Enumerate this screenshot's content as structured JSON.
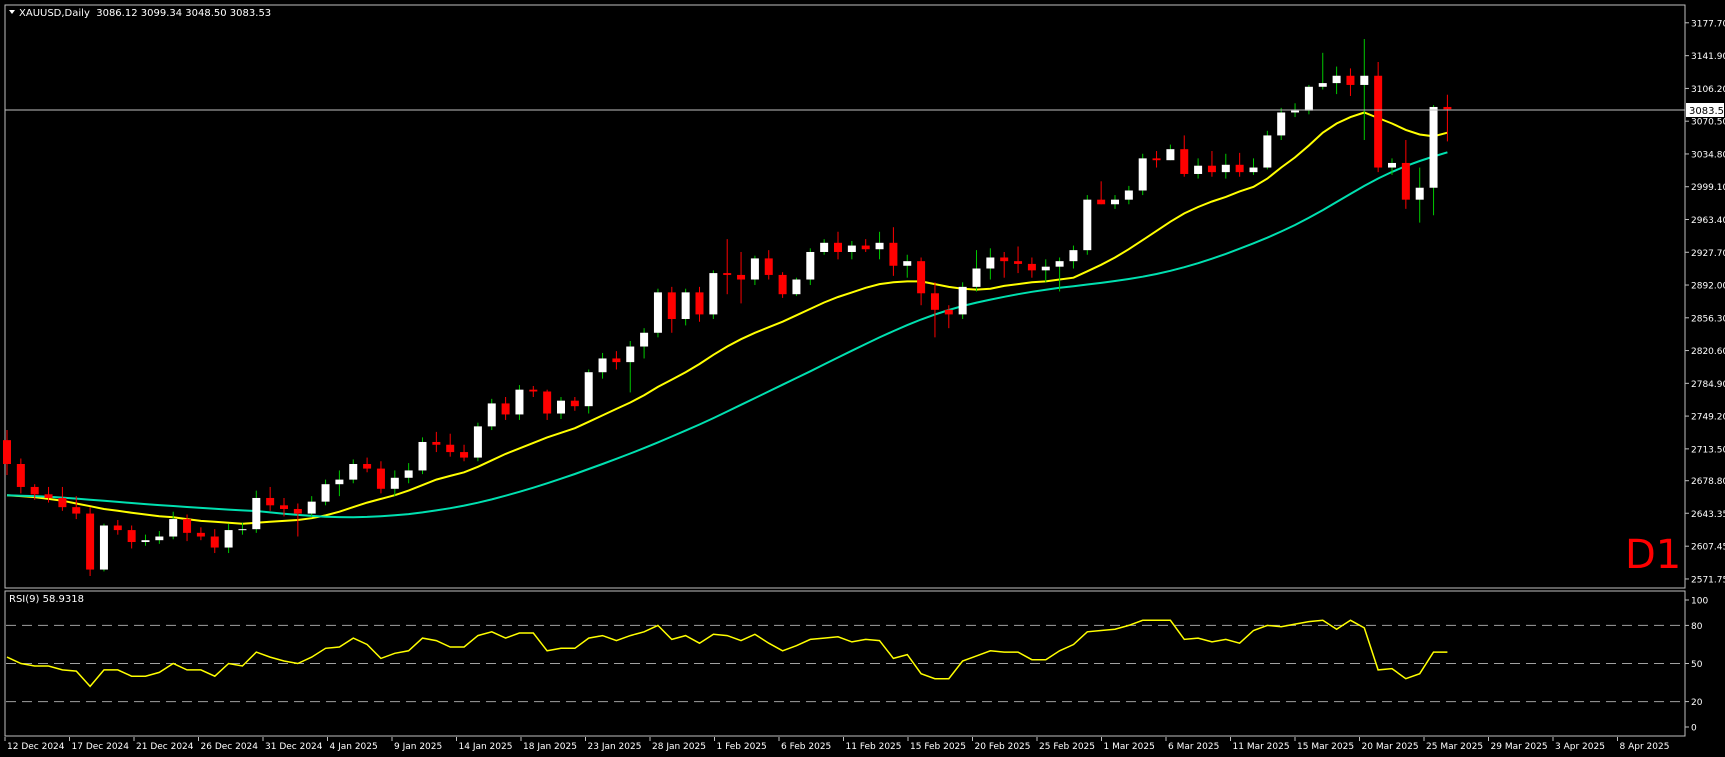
{
  "header": {
    "symbol_line": "XAUUSD,Daily  3086.12 3099.34 3048.50 3083.53",
    "watermark": "D1",
    "current_price_label": "3083.53"
  },
  "rsi_header": "RSI(9) 58.9318",
  "colors": {
    "background": "#000000",
    "frame": "#c0c0c0",
    "bull_body": "#ffffff",
    "bull_wick": "#00c800",
    "bear": "#ff0000",
    "ma_fast": "#ffff00",
    "ma_slow": "#00e0b0",
    "rsi_line": "#ffff00",
    "text": "#ffffff",
    "watermark": "#ff0000"
  },
  "chart_data": [
    {
      "type": "candlestick",
      "title": "XAUUSD,Daily",
      "ohlc_last": {
        "open": 3086.12,
        "high": 3099.34,
        "low": 3048.5,
        "close": 3083.53
      },
      "ylim": [
        2563,
        3196
      ],
      "yticks": [
        3177.7,
        3141.9,
        3106.2,
        3070.5,
        3034.8,
        2999.1,
        2963.4,
        2927.7,
        2892.0,
        2856.3,
        2820.6,
        2784.9,
        2749.2,
        2713.5,
        2678.8,
        2643.35,
        2607.45,
        2571.75
      ],
      "xticks": [
        "12 Dec 2024",
        "17 Dec 2024",
        "21 Dec 2024",
        "26 Dec 2024",
        "31 Dec 2024",
        "4 Jan 2025",
        "9 Jan 2025",
        "14 Jan 2025",
        "18 Jan 2025",
        "23 Jan 2025",
        "28 Jan 2025",
        "1 Feb 2025",
        "6 Feb 2025",
        "11 Feb 2025",
        "15 Feb 2025",
        "20 Feb 2025",
        "25 Feb 2025",
        "1 Mar 2025",
        "6 Mar 2025",
        "11 Mar 2025",
        "15 Mar 2025",
        "20 Mar 2025",
        "25 Mar 2025",
        "29 Mar 2025",
        "3 Apr 2025",
        "8 Apr 2025"
      ],
      "candles": [
        [
          2723,
          2734,
          2685,
          2697
        ],
        [
          2697,
          2703,
          2665,
          2672
        ],
        [
          2672,
          2675,
          2658,
          2664
        ],
        [
          2664,
          2672,
          2655,
          2660
        ],
        [
          2660,
          2672,
          2646,
          2650
        ],
        [
          2650,
          2662,
          2637,
          2643
        ],
        [
          2643,
          2650,
          2575,
          2582
        ],
        [
          2582,
          2632,
          2580,
          2630
        ],
        [
          2630,
          2636,
          2620,
          2625
        ],
        [
          2625,
          2630,
          2605,
          2612
        ],
        [
          2612,
          2620,
          2608,
          2614
        ],
        [
          2614,
          2624,
          2610,
          2618
        ],
        [
          2618,
          2645,
          2615,
          2637
        ],
        [
          2637,
          2642,
          2613,
          2622
        ],
        [
          2622,
          2628,
          2614,
          2618
        ],
        [
          2618,
          2626,
          2600,
          2606
        ],
        [
          2606,
          2632,
          2600,
          2625
        ],
        [
          2625,
          2633,
          2620,
          2626
        ],
        [
          2626,
          2668,
          2622,
          2660
        ],
        [
          2660,
          2672,
          2646,
          2652
        ],
        [
          2652,
          2660,
          2640,
          2648
        ],
        [
          2648,
          2654,
          2618,
          2643
        ],
        [
          2643,
          2662,
          2640,
          2656
        ],
        [
          2656,
          2680,
          2652,
          2675
        ],
        [
          2675,
          2690,
          2662,
          2680
        ],
        [
          2680,
          2702,
          2676,
          2697
        ],
        [
          2697,
          2704,
          2688,
          2692
        ],
        [
          2692,
          2700,
          2665,
          2670
        ],
        [
          2670,
          2690,
          2662,
          2682
        ],
        [
          2682,
          2698,
          2676,
          2690
        ],
        [
          2690,
          2726,
          2686,
          2721
        ],
        [
          2721,
          2732,
          2710,
          2718
        ],
        [
          2718,
          2730,
          2705,
          2710
        ],
        [
          2710,
          2718,
          2700,
          2704
        ],
        [
          2704,
          2742,
          2700,
          2738
        ],
        [
          2738,
          2768,
          2734,
          2763
        ],
        [
          2763,
          2770,
          2745,
          2751
        ],
        [
          2751,
          2783,
          2745,
          2778
        ],
        [
          2778,
          2782,
          2770,
          2776
        ],
        [
          2776,
          2778,
          2745,
          2752
        ],
        [
          2752,
          2770,
          2746,
          2766
        ],
        [
          2766,
          2770,
          2755,
          2760
        ],
        [
          2760,
          2800,
          2752,
          2797
        ],
        [
          2797,
          2818,
          2790,
          2812
        ],
        [
          2812,
          2820,
          2800,
          2808
        ],
        [
          2808,
          2831,
          2775,
          2825
        ],
        [
          2825,
          2845,
          2812,
          2840
        ],
        [
          2840,
          2888,
          2835,
          2884
        ],
        [
          2884,
          2890,
          2840,
          2855
        ],
        [
          2855,
          2888,
          2848,
          2884
        ],
        [
          2884,
          2890,
          2852,
          2860
        ],
        [
          2860,
          2908,
          2855,
          2905
        ],
        [
          2905,
          2942,
          2882,
          2903
        ],
        [
          2903,
          2928,
          2872,
          2898
        ],
        [
          2898,
          2924,
          2892,
          2921
        ],
        [
          2921,
          2930,
          2898,
          2903
        ],
        [
          2903,
          2906,
          2878,
          2882
        ],
        [
          2882,
          2900,
          2880,
          2898
        ],
        [
          2898,
          2932,
          2892,
          2928
        ],
        [
          2928,
          2942,
          2925,
          2938
        ],
        [
          2938,
          2950,
          2920,
          2928
        ],
        [
          2928,
          2940,
          2920,
          2935
        ],
        [
          2935,
          2942,
          2928,
          2931
        ],
        [
          2931,
          2950,
          2920,
          2938
        ],
        [
          2938,
          2955,
          2902,
          2913
        ],
        [
          2913,
          2925,
          2900,
          2918
        ],
        [
          2918,
          2922,
          2870,
          2883
        ],
        [
          2883,
          2895,
          2835,
          2865
        ],
        [
          2865,
          2870,
          2845,
          2860
        ],
        [
          2860,
          2895,
          2855,
          2890
        ],
        [
          2890,
          2930,
          2885,
          2910
        ],
        [
          2910,
          2932,
          2898,
          2922
        ],
        [
          2922,
          2928,
          2900,
          2918
        ],
        [
          2918,
          2934,
          2905,
          2915
        ],
        [
          2915,
          2922,
          2900,
          2908
        ],
        [
          2908,
          2920,
          2895,
          2912
        ],
        [
          2912,
          2922,
          2885,
          2918
        ],
        [
          2918,
          2935,
          2910,
          2930
        ],
        [
          2930,
          2990,
          2925,
          2985
        ],
        [
          2985,
          3005,
          2980,
          2980
        ],
        [
          2980,
          2990,
          2975,
          2985
        ],
        [
          2985,
          3000,
          2980,
          2995
        ],
        [
          2995,
          3035,
          2990,
          3030
        ],
        [
          3030,
          3038,
          3020,
          3028
        ],
        [
          3028,
          3045,
          3028,
          3040
        ],
        [
          3040,
          3055,
          3010,
          3013
        ],
        [
          3013,
          3030,
          3008,
          3022
        ],
        [
          3022,
          3038,
          3010,
          3015
        ],
        [
          3015,
          3035,
          3008,
          3023
        ],
        [
          3023,
          3036,
          3010,
          3015
        ],
        [
          3015,
          3030,
          3012,
          3020
        ],
        [
          3020,
          3060,
          3018,
          3055
        ],
        [
          3055,
          3085,
          3050,
          3080
        ],
        [
          3080,
          3090,
          3075,
          3082
        ],
        [
          3082,
          3110,
          3078,
          3108
        ],
        [
          3108,
          3145,
          3105,
          3112
        ],
        [
          3112,
          3130,
          3100,
          3120
        ],
        [
          3120,
          3128,
          3098,
          3110
        ],
        [
          3110,
          3160,
          3050,
          3120
        ],
        [
          3120,
          3135,
          3015,
          3020
        ],
        [
          3020,
          3030,
          3012,
          3025
        ],
        [
          3025,
          3050,
          2975,
          2985
        ],
        [
          2985,
          3020,
          2960,
          2998
        ],
        [
          2998,
          3088,
          2968,
          3086
        ],
        [
          3086,
          3099.34,
          3048.5,
          3083.53
        ]
      ],
      "ma_fast": [
        2663,
        2662,
        2661,
        2659,
        2657,
        2654,
        2651,
        2648,
        2646,
        2644,
        2642,
        2640,
        2639,
        2637,
        2635,
        2634,
        2633,
        2632,
        2633,
        2634,
        2635,
        2636,
        2638,
        2641,
        2645,
        2650,
        2655,
        2659,
        2663,
        2668,
        2674,
        2680,
        2684,
        2688,
        2694,
        2701,
        2708,
        2714,
        2720,
        2726,
        2731,
        2736,
        2743,
        2750,
        2757,
        2764,
        2772,
        2781,
        2789,
        2797,
        2806,
        2816,
        2825,
        2833,
        2840,
        2846,
        2852,
        2859,
        2866,
        2873,
        2879,
        2884,
        2889,
        2893,
        2895,
        2896,
        2896,
        2893,
        2890,
        2888,
        2887,
        2888,
        2891,
        2893,
        2895,
        2896,
        2898,
        2900,
        2907,
        2914,
        2922,
        2931,
        2941,
        2951,
        2961,
        2970,
        2977,
        2983,
        2988,
        2994,
        2999,
        3008,
        3020,
        3031,
        3044,
        3058,
        3068,
        3075,
        3080,
        3074,
        3068,
        3061,
        3056,
        3054,
        3058
      ]
    },
    {
      "type": "line",
      "title": "RSI(9) 58.9318",
      "ylim": [
        0,
        100
      ],
      "yticks": [
        100,
        80,
        50,
        20,
        0
      ],
      "levels": [
        80,
        50,
        20
      ],
      "values": [
        55,
        50,
        48,
        48,
        45,
        44,
        32,
        45,
        45,
        40,
        40,
        43,
        50,
        45,
        45,
        40,
        50,
        48,
        59,
        55,
        52,
        50,
        55,
        62,
        63,
        70,
        65,
        54,
        58,
        60,
        70,
        68,
        63,
        63,
        72,
        75,
        70,
        74,
        74,
        60,
        62,
        62,
        70,
        72,
        68,
        72,
        75,
        80,
        69,
        72,
        66,
        73,
        72,
        68,
        73,
        66,
        60,
        64,
        69,
        70,
        71,
        67,
        69,
        68,
        54,
        57,
        42,
        38,
        38,
        52,
        56,
        60,
        59,
        59,
        53,
        53,
        60,
        65,
        75,
        76,
        77,
        80,
        84,
        84,
        84,
        69,
        70,
        67,
        69,
        66,
        76,
        80,
        79,
        81,
        83,
        84,
        77,
        84,
        78,
        45,
        46,
        38,
        42,
        59,
        59
      ]
    }
  ]
}
